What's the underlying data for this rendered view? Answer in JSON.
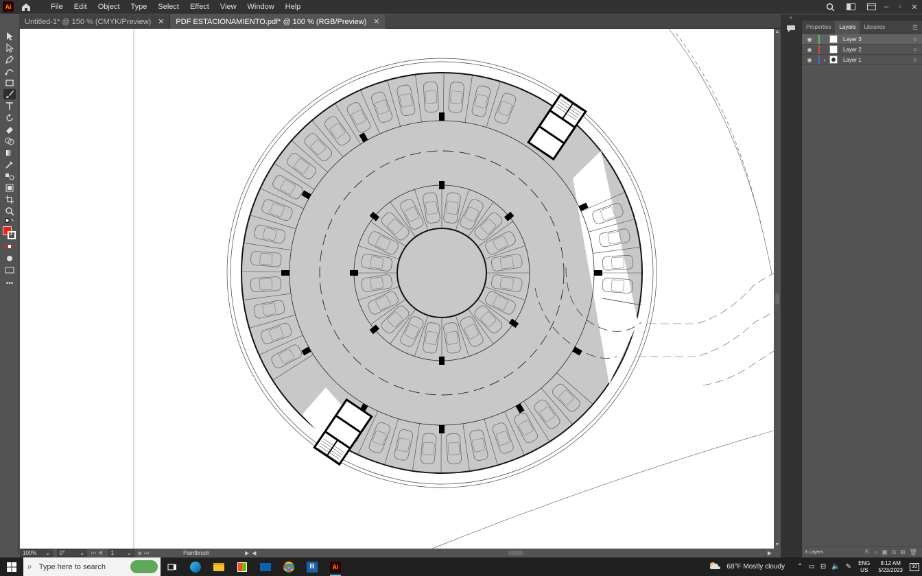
{
  "app": {
    "logo": "Ai",
    "name": "Adobe Illustrator"
  },
  "menu": [
    "File",
    "Edit",
    "Object",
    "Type",
    "Select",
    "Effect",
    "View",
    "Window",
    "Help"
  ],
  "tabs": [
    {
      "label": "Untitled-1* @ 150 % (CMYK/Preview)",
      "active": false
    },
    {
      "label": "PDF ESTACIONAMIENTO.pdf* @ 100 % (RGB/Preview)",
      "active": true
    }
  ],
  "tools": [
    "selection-tool",
    "direct-selection-tool",
    "pen-tool",
    "curvature-tool",
    "rectangle-tool",
    "paintbrush-tool",
    "type-tool",
    "rotate-tool",
    "eraser-tool",
    "shape-builder-tool",
    "gradient-tool",
    "eyedropper-tool",
    "blend-tool",
    "artboard-tool",
    "crop-tool",
    "zoom-tool"
  ],
  "status": {
    "zoom": "100%",
    "rotation": "0°",
    "artboard": "1",
    "current_tool": "Paintbrush"
  },
  "fill_color": "#e8231c",
  "panel": {
    "tabs": [
      "Properties",
      "Layers",
      "Libraries"
    ],
    "active_tab": "Layers",
    "layers": [
      {
        "name": "Layer 3",
        "color": "#4fc24f",
        "selected": true
      },
      {
        "name": "Layer 2",
        "color": "#d94141",
        "selected": false
      },
      {
        "name": "Layer 1",
        "color": "#3d6fe0",
        "selected": false
      }
    ],
    "footer": "3 Layers"
  },
  "taskbar": {
    "search_placeholder": "Type here to search",
    "weather": "68°F  Mostly cloudy",
    "lang": "ENG",
    "region": "US",
    "time": "8:12 AM",
    "date": "5/23/2023",
    "notifications": "10"
  }
}
